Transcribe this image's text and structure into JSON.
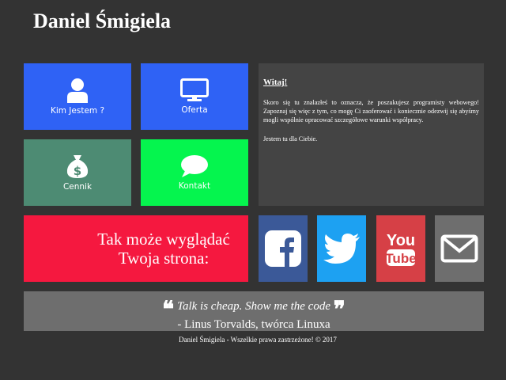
{
  "header": {
    "title": "Daniel Śmigiela"
  },
  "tiles": {
    "about": {
      "label": "Kim Jestem ?",
      "icon": "user-icon"
    },
    "offer": {
      "label": "Oferta",
      "icon": "monitor-icon"
    },
    "pricing": {
      "label": "Cennik",
      "icon": "money-bag-icon"
    },
    "contact": {
      "label": "Kontakt",
      "icon": "speech-bubble-icon"
    }
  },
  "welcome": {
    "heading": "Witaj!",
    "paragraph1": "Skoro się tu znalazłeś to oznacza, że poszukujesz programisty webowego! Zapoznaj się więc z tym, co mogę Ci zaoferować i koniecznie odezwij się abyśmy mogli wspólnie opracować szczegółowe warunki współpracy.",
    "paragraph2": "Jestem tu dla Ciebie."
  },
  "promo": {
    "line1": "Tak może wyglądać",
    "line2": "Twoja strona:"
  },
  "social": {
    "facebook": "facebook-icon",
    "twitter": "twitter-icon",
    "youtube": "youtube-icon",
    "mail": "mail-icon"
  },
  "quote": {
    "text": "Talk is cheap. Show me the code",
    "open_mark": "❝",
    "close_mark": "❞",
    "author": "- Linus Torvalds, twórca Linuxa"
  },
  "footer": {
    "text": "Daniel Śmigiela - Wszelkie prawa zastrzeżone! © 2017"
  },
  "colors": {
    "background": "#333333",
    "tile_blue": "#2f62f5",
    "tile_teal": "#4d8b73",
    "tile_green": "#05f54e",
    "promo_red": "#f5183f",
    "facebook": "#3b5998",
    "twitter": "#1da1f2",
    "youtube": "#d64046",
    "mail": "#6e6e6e"
  }
}
